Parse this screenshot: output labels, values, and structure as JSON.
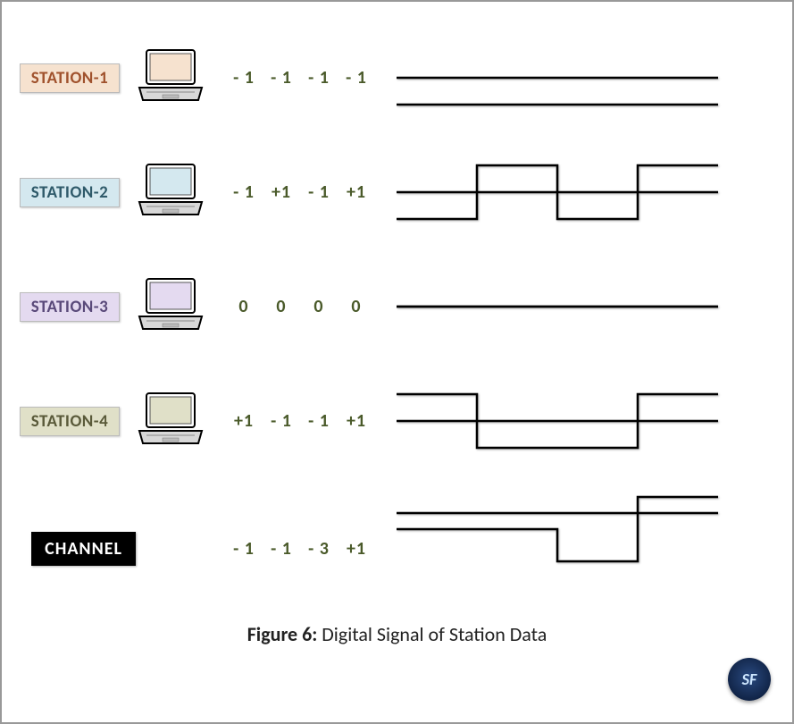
{
  "rows": [
    {
      "label": "STATION-1",
      "badgeBg": "#f6e2cf",
      "badgeColor": "#a0522d",
      "screenFill": "#f6e2cf",
      "values": [
        "- 1",
        "- 1",
        "- 1",
        "- 1"
      ],
      "signal": [
        -1,
        -1,
        -1,
        -1
      ]
    },
    {
      "label": "STATION-2",
      "badgeBg": "#d4e8ef",
      "badgeColor": "#2f5a6a",
      "screenFill": "#d4e8ef",
      "values": [
        "- 1",
        "+1",
        "- 1",
        "+1"
      ],
      "signal": [
        -1,
        1,
        -1,
        1
      ]
    },
    {
      "label": "STATION-3",
      "badgeBg": "#e4daf0",
      "badgeColor": "#5a4a7a",
      "screenFill": "#e4daf0",
      "values": [
        "0",
        "0",
        "0",
        "0"
      ],
      "signal": [
        0,
        0,
        0,
        0
      ]
    },
    {
      "label": "STATION-4",
      "badgeBg": "#e0e0c8",
      "badgeColor": "#5a5a3a",
      "screenFill": "#e0e0c8",
      "values": [
        "+1",
        "- 1",
        "- 1",
        "+1"
      ],
      "signal": [
        1,
        -1,
        -1,
        1
      ]
    }
  ],
  "channel": {
    "label": "CHANNEL",
    "values": [
      "- 1",
      "- 1",
      "- 3",
      "+1"
    ],
    "signal": [
      -1,
      -1,
      -3,
      1
    ]
  },
  "caption": {
    "bold": "Figure 6:",
    "text": "  Digital Signal of Station Data"
  },
  "logo": "SF"
}
